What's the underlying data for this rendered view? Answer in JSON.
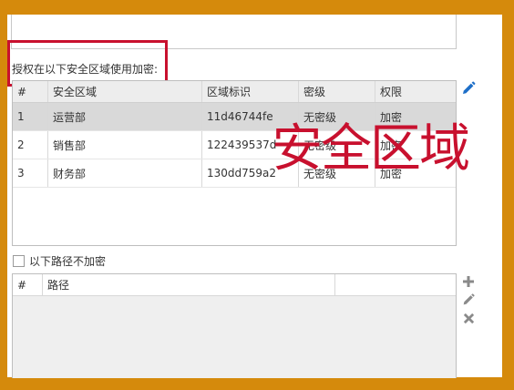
{
  "auth_label": "授权在以下安全区域使用加密:",
  "overlay_text": "安全区域",
  "zones_table": {
    "headers": [
      "#",
      "安全区域",
      "区域标识",
      "密级",
      "权限"
    ],
    "rows": [
      [
        "1",
        "运营部",
        "11d46744fe",
        "无密级",
        "加密"
      ],
      [
        "2",
        "销售部",
        "122439537d",
        "无密级",
        "加密"
      ],
      [
        "3",
        "财务部",
        "130dd759a2",
        "无密级",
        "加密"
      ]
    ]
  },
  "exclude_checkbox_label": "以下路径不加密",
  "paths_table": {
    "headers": [
      "#",
      "路径",
      ""
    ]
  },
  "icons": {
    "edit": "pencil-icon",
    "add": "plus-icon",
    "remove": "close-icon"
  },
  "colors": {
    "frame": "#D58A0C",
    "highlight": "#C8102E",
    "icon_blue": "#1E6FC8",
    "icon_gray": "#8A8A8A"
  }
}
